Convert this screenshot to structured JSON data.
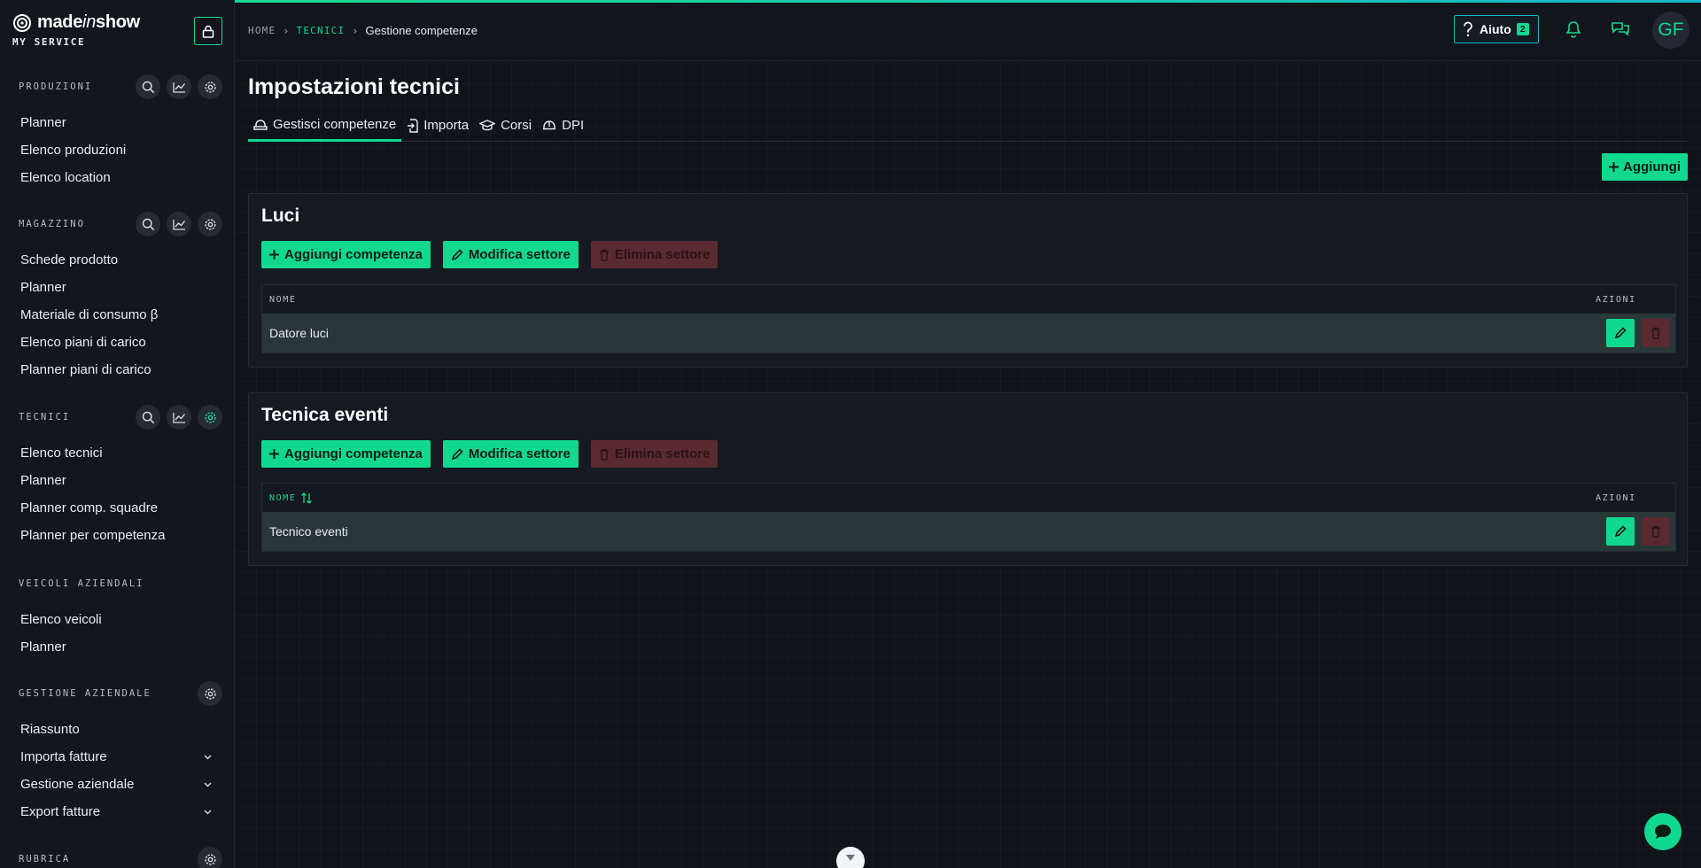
{
  "brand": {
    "name_prefix": "made",
    "name_italic": "in",
    "name_suffix": "show",
    "subtitle": "MY SERVICE"
  },
  "sidebar": {
    "sections": [
      {
        "title": "PRODUZIONI",
        "items": [
          "Planner",
          "Elenco produzioni",
          "Elenco location"
        ]
      },
      {
        "title": "MAGAZZINO",
        "items": [
          "Schede prodotto",
          "Planner",
          "Materiale di consumo β",
          "Elenco piani di carico",
          "Planner piani di carico"
        ]
      },
      {
        "title": "TECNICI",
        "items": [
          "Elenco tecnici",
          "Planner",
          "Planner comp. squadre",
          "Planner per competenza"
        ]
      },
      {
        "title": "VEICOLI AZIENDALI",
        "items": [
          "Elenco veicoli",
          "Planner"
        ]
      },
      {
        "title": "GESTIONE AZIENDALE",
        "items": [
          "Riassunto",
          "Importa fatture",
          "Gestione aziendale",
          "Export fatture"
        ]
      },
      {
        "title": "RUBRICA",
        "items": []
      }
    ]
  },
  "breadcrumb": {
    "home": "HOME",
    "section": "TECNICI",
    "current": "Gestione competenze"
  },
  "topbar": {
    "help_label": "Aiuto",
    "help_count": "2",
    "avatar_initials": "GF"
  },
  "page": {
    "title": "Impostazioni tecnici",
    "tabs": [
      {
        "label": "Gestisci competenze",
        "icon": "hardhat-icon"
      },
      {
        "label": "Importa",
        "icon": "file-import-icon"
      },
      {
        "label": "Corsi",
        "icon": "graduation-cap-icon"
      },
      {
        "label": "DPI",
        "icon": "helmet-icon"
      }
    ],
    "add_label": "Aggiungi"
  },
  "sectors": [
    {
      "title": "Luci",
      "add_skill_label": "Aggiungi competenza",
      "edit_sector_label": "Modifica settore",
      "delete_sector_label": "Elimina settore",
      "col_name": "NOME",
      "col_actions": "AZIONI",
      "rows": [
        "Datore luci"
      ]
    },
    {
      "title": "Tecnica eventi",
      "add_skill_label": "Aggiungi competenza",
      "edit_sector_label": "Modifica settore",
      "delete_sector_label": "Elimina settore",
      "col_name": "NOME",
      "col_actions": "AZIONI",
      "rows": [
        "Tecnico eventi"
      ]
    }
  ],
  "colors": {
    "accent": "#10d98e",
    "accent_cyan": "#12b8c9",
    "danger": "#5a2a30",
    "bg": "#10131a"
  }
}
